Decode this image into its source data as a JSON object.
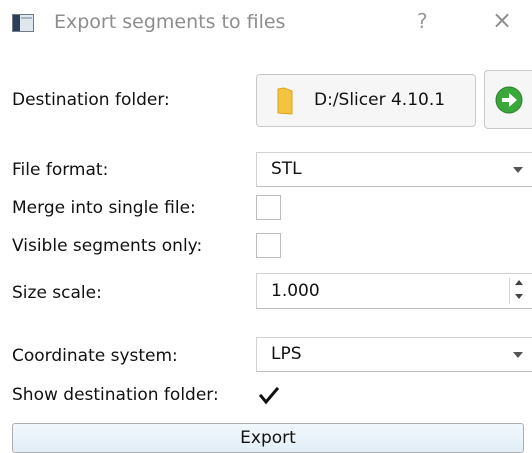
{
  "window": {
    "title": "Export segments to files",
    "help": "?",
    "close": "×"
  },
  "form": {
    "destination_folder": {
      "label": "Destination folder:",
      "value": "D:/Slicer 4.10.1"
    },
    "file_format": {
      "label": "File format:",
      "value": "STL"
    },
    "merge_single_file": {
      "label": "Merge into single file:",
      "checked": false
    },
    "visible_segments_only": {
      "label": "Visible segments only:",
      "checked": false
    },
    "size_scale": {
      "label": "Size scale:",
      "value": "1.000"
    },
    "coordinate_system": {
      "label": "Coordinate system:",
      "value": "LPS"
    },
    "show_destination_folder": {
      "label": "Show destination folder:",
      "checked": true
    }
  },
  "actions": {
    "export": "Export"
  },
  "colors": {
    "folder": "#f5c342",
    "go_arrow": "#3aa73a",
    "export_bg": "#e6f0f8"
  },
  "icons": {
    "app": "app-window-icon",
    "folder": "folder-icon",
    "open": "arrow-right-circle-icon",
    "check": "checkmark-icon"
  }
}
